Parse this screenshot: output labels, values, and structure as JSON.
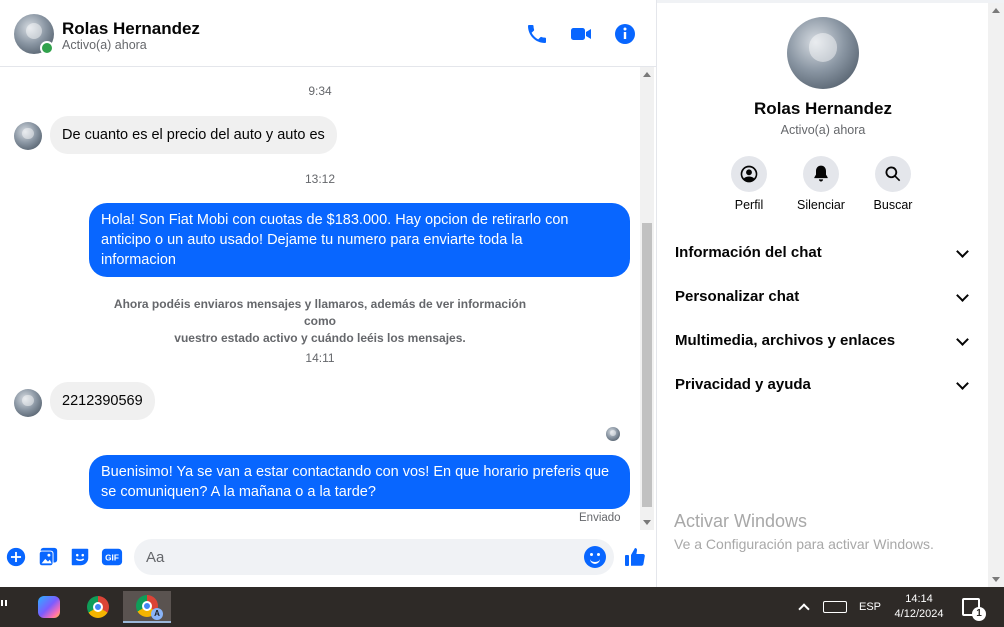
{
  "header": {
    "name": "Rolas Hernandez",
    "status": "Activo(a) ahora",
    "icons": [
      "phone-icon",
      "video-icon",
      "info-icon"
    ]
  },
  "messages": {
    "time1": "9:34",
    "in1": "De cuanto es el precio del auto y auto es",
    "time2": "13:12",
    "out1_line1": "Hola! Son Fiat Mobi con cuotas de $183.000. Hay opcion de retirarlo con",
    "out1_line2": "anticipo o un auto usado! Dejame tu numero para enviarte toda la",
    "out1_line3": "informacion",
    "notice_line1": "Ahora podéis enviaros mensajes y llamaros, además de ver información como",
    "notice_line2": "vuestro estado activo y cuándo leéis los mensajes.",
    "time3": "14:11",
    "in2": "2212390569",
    "out2_line1": "Buenisimo! Ya se van a estar contactando con vos! En que horario preferis que",
    "out2_line2": "se comuniquen? A la mañana o a la tarde?",
    "sent_label": "Enviado"
  },
  "composer": {
    "placeholder": "Aa",
    "icons": [
      "plus-icon",
      "image-icon",
      "sticker-icon",
      "gif-icon",
      "emoji-icon",
      "like-icon"
    ],
    "gif_label": "GIF"
  },
  "side": {
    "name": "Rolas Hernandez",
    "status": "Activo(a) ahora",
    "actions": [
      {
        "label": "Perfil",
        "icon": "profile-icon"
      },
      {
        "label": "Silenciar",
        "icon": "bell-icon"
      },
      {
        "label": "Buscar",
        "icon": "search-icon"
      }
    ],
    "sections": [
      {
        "label": "Información del chat"
      },
      {
        "label": "Personalizar chat"
      },
      {
        "label": "Multimedia, archivos y enlaces"
      },
      {
        "label": "Privacidad y ayuda"
      }
    ],
    "watermark_title": "Activar Windows",
    "watermark_sub": "Ve a Configuración para activar Windows."
  },
  "taskbar": {
    "lang": "ESP",
    "time": "14:14",
    "date": "4/12/2024",
    "notification_count": "1",
    "active_tab_letter": "A"
  },
  "colors": {
    "accent": "#0866ff",
    "online": "#31a24c",
    "taskbar": "#2e2a27"
  }
}
